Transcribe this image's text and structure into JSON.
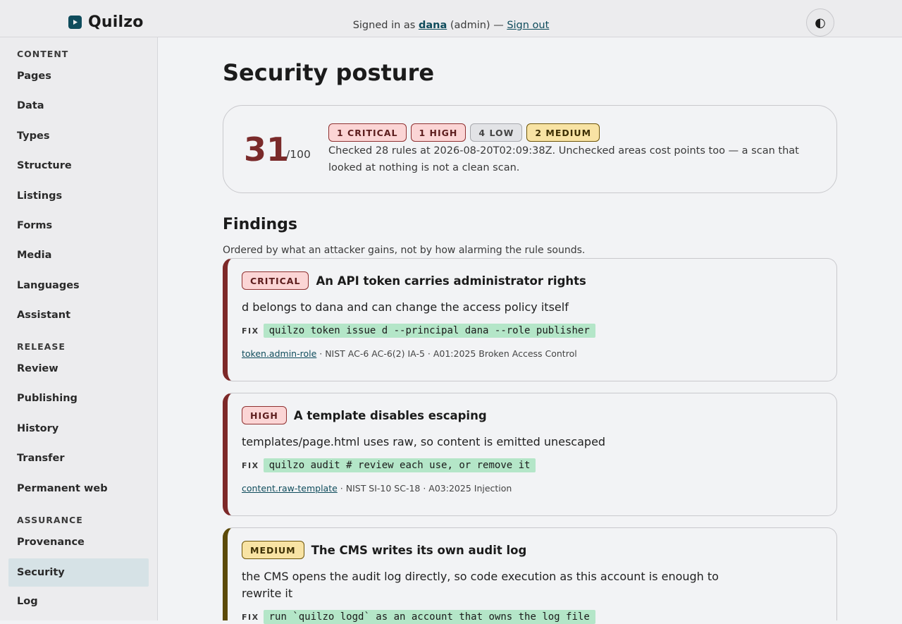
{
  "header": {
    "app_name": "Quilzo",
    "signed_in_prefix": "Signed in as",
    "user": "dana",
    "role_text": "(admin) —",
    "sign_out": "Sign out",
    "theme_toggle_glyph": "◐"
  },
  "sidebar": {
    "sections": [
      {
        "title": "CONTENT",
        "items": [
          "Pages",
          "Data",
          "Types",
          "Structure",
          "Listings",
          "Forms",
          "Media",
          "Languages",
          "Assistant"
        ]
      },
      {
        "title": "RELEASE",
        "items": [
          "Review",
          "Publishing",
          "History",
          "Transfer",
          "Permanent web"
        ]
      },
      {
        "title": "ASSURANCE",
        "items": [
          "Provenance",
          "Security",
          "Log"
        ]
      }
    ],
    "active": "Security"
  },
  "page": {
    "title": "Security posture"
  },
  "score": {
    "value": "31",
    "max": "/100",
    "badges": [
      "1 CRITICAL",
      "1 HIGH",
      "4 LOW",
      "2 MEDIUM"
    ],
    "description": "Checked 28 rules at 2026-08-20T02:09:38Z. Unchecked areas cost points too — a scan that looked at nothing is not a clean scan."
  },
  "findings": {
    "heading": "Findings",
    "subtitle": "Ordered by what an attacker gains, not by how alarming the rule sounds.",
    "fix_label": "FIX",
    "items": [
      {
        "severity": "CRITICAL",
        "title": "An API token carries administrator rights",
        "description": "d belongs to dana and can change the access policy itself",
        "fix": "quilzo token issue d --principal dana --role publisher",
        "rule": "token.admin-role",
        "refs": " · NIST AC-6 AC-6(2) IA-5 · A01:2025 Broken Access Control"
      },
      {
        "severity": "HIGH",
        "title": "A template disables escaping",
        "description": "templates/page.html uses raw, so content is emitted unescaped",
        "fix": "quilzo audit # review each use, or remove it",
        "rule": "content.raw-template",
        "refs": " · NIST SI-10 SC-18 · A03:2025 Injection"
      },
      {
        "severity": "MEDIUM",
        "title": "The CMS writes its own audit log",
        "description": "the CMS opens the audit log directly, so code execution as this account is enough to rewrite it",
        "fix": "run `quilzo logd` as an account that owns the log file",
        "rule": "",
        "refs": ""
      }
    ]
  },
  "colors": {
    "accent": "#0f4c5c",
    "critical": "#7d2828",
    "medium": "#5c4a08",
    "fix_bg": "#b4e6c8"
  }
}
